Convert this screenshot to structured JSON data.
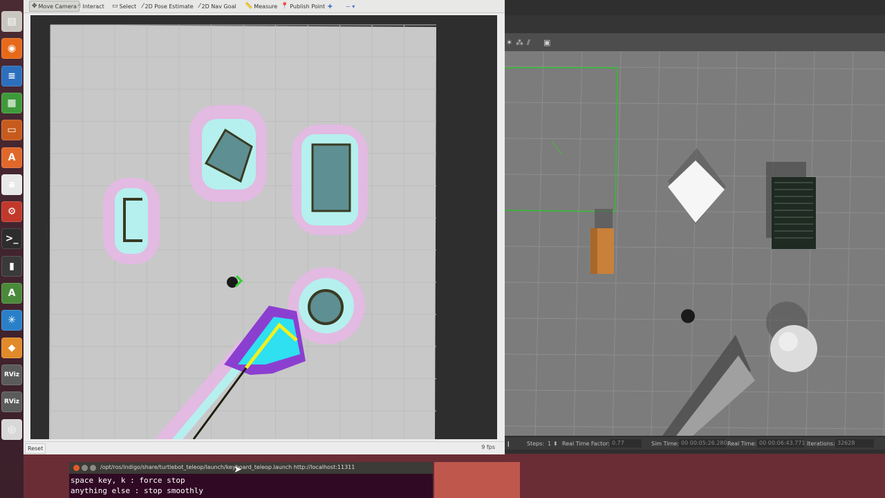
{
  "launcher": {
    "items": [
      {
        "icon": "files-icon",
        "glyph": "▤",
        "color": "#c9c6c0"
      },
      {
        "icon": "firefox-icon",
        "glyph": "◉",
        "color": "#e66a1a"
      },
      {
        "icon": "writer-icon",
        "glyph": "≡",
        "color": "#2c6fbd"
      },
      {
        "icon": "calc-icon",
        "glyph": "▦",
        "color": "#3e9a3a"
      },
      {
        "icon": "impress-icon",
        "glyph": "▭",
        "color": "#c65b1d"
      },
      {
        "icon": "software-center-icon",
        "glyph": "A",
        "color": "#e0682b"
      },
      {
        "icon": "amazon-icon",
        "glyph": "a",
        "color": "#e8e8e8"
      },
      {
        "icon": "settings-icon",
        "glyph": "⚙",
        "color": "#c0392b"
      },
      {
        "icon": "terminal-icon",
        "glyph": ">_",
        "color": "#2d2d2d"
      },
      {
        "icon": "usb-icon",
        "glyph": "▮",
        "color": "#3a3a3a"
      },
      {
        "icon": "update-icon",
        "glyph": "A",
        "color": "#4a8a3a"
      },
      {
        "icon": "display-icon",
        "glyph": "✳",
        "color": "#2a80c8"
      },
      {
        "icon": "gazebo-icon",
        "glyph": "◆",
        "color": "#e08a2a"
      },
      {
        "icon": "rviz-icon",
        "glyph": "RViz",
        "color": "#5b5b5b"
      },
      {
        "icon": "rviz-icon",
        "glyph": "RViz",
        "color": "#5b5b5b"
      },
      {
        "icon": "dvd-icon",
        "glyph": "◎",
        "color": "#d8d8d8"
      }
    ]
  },
  "rviz": {
    "toolbar": [
      {
        "label": "Move Camera",
        "icon": "move-camera-icon",
        "glyph": "✥",
        "active": true
      },
      {
        "label": "Interact",
        "icon": "interact-icon",
        "glyph": "☝",
        "active": false
      },
      {
        "label": "Select",
        "icon": "select-icon",
        "glyph": "▭",
        "active": false
      },
      {
        "label": "2D Pose Estimate",
        "icon": "pose-estimate-icon",
        "glyph": "⁄",
        "active": false
      },
      {
        "label": "2D Nav Goal",
        "icon": "nav-goal-icon",
        "glyph": "⁄",
        "active": false
      },
      {
        "label": "Measure",
        "icon": "measure-icon",
        "glyph": "📏",
        "active": false
      },
      {
        "label": "Publish Point",
        "icon": "publish-point-icon",
        "glyph": "📍",
        "active": false
      }
    ],
    "add_tool_glyph": "✚",
    "remove_tool_glyph": "−",
    "reset_label": "Reset",
    "fps": "9 fps",
    "colors": {
      "map_free": "#c8c8c8",
      "grid": "#b8b8b8",
      "inflation_outer": "#e4b8e4",
      "inflation_inner": "#b5f0ee",
      "obstacle": "#3a3a22"
    }
  },
  "gazebo": {
    "status": {
      "steps_label": "Steps:",
      "steps_value": "1",
      "rtf_label": "Real Time Factor:",
      "rtf_value": "0.77",
      "sim_time_label": "Sim Time:",
      "sim_time_value": "00 00:05:26.280",
      "real_time_label": "Real Time:",
      "real_time_value": "00 00:06:43.771",
      "iterations_label": "Iterations:",
      "iterations_value": "32628"
    },
    "colors": {
      "ground": "#7c7c7c",
      "grid": "#9a9a9a",
      "selection": "#2fbf2f"
    }
  },
  "terminal": {
    "title": "/opt/ros/indigo/share/turtlebot_teleop/launch/keyboard_teleop.launch http://localhost:11311",
    "lines": [
      "space key, k : force stop",
      "anything else : stop smoothly"
    ]
  }
}
